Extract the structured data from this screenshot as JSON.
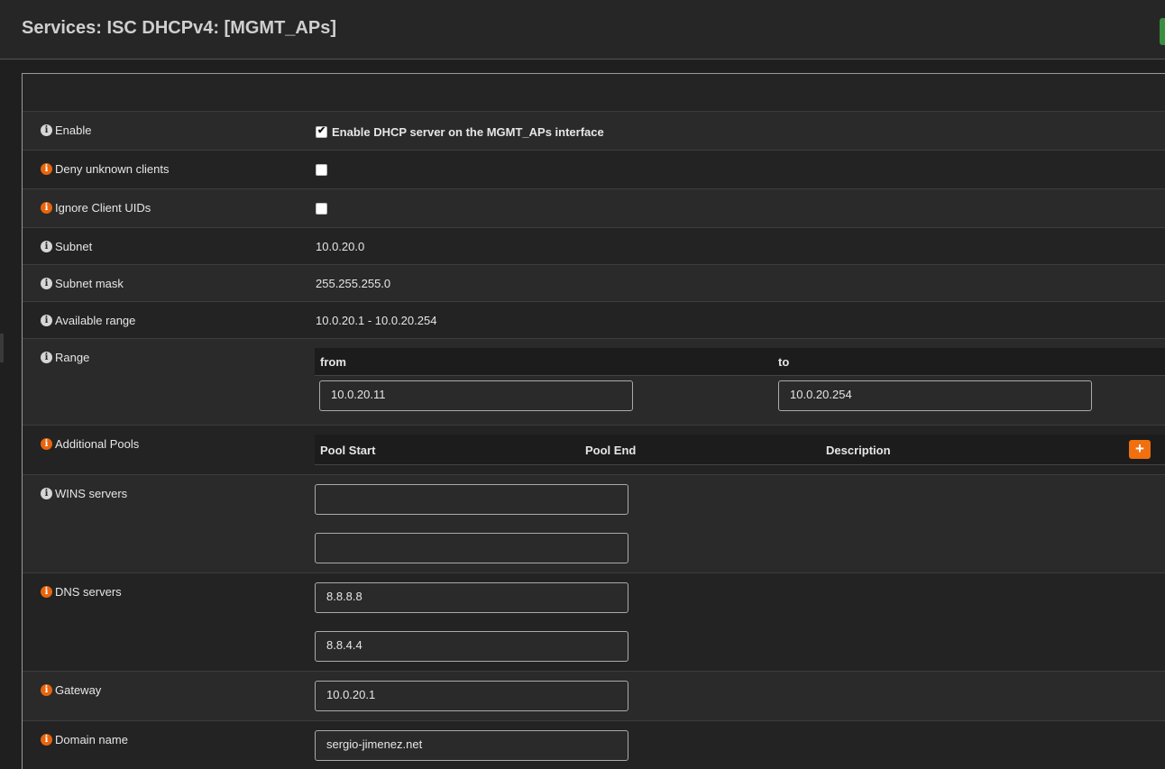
{
  "page": {
    "title": "Services: ISC DHCPv4: [MGMT_APs]"
  },
  "form": {
    "enable": {
      "label": "Enable",
      "checkbox_label": "Enable DHCP server on the MGMT_APs interface",
      "checked": true
    },
    "deny_unknown": {
      "label": "Deny unknown clients",
      "checked": false
    },
    "ignore_uids": {
      "label": "Ignore Client UIDs",
      "checked": false
    },
    "subnet": {
      "label": "Subnet",
      "value": "10.0.20.0"
    },
    "subnet_mask": {
      "label": "Subnet mask",
      "value": "255.255.255.0"
    },
    "available_range": {
      "label": "Available range",
      "value": "10.0.20.1 - 10.0.20.254"
    },
    "range": {
      "label": "Range",
      "from_label": "from",
      "to_label": "to",
      "from_value": "10.0.20.11",
      "to_value": "10.0.20.254"
    },
    "additional_pools": {
      "label": "Additional Pools",
      "col_start": "Pool Start",
      "col_end": "Pool End",
      "col_desc": "Description",
      "add_label": "+"
    },
    "wins": {
      "label": "WINS servers",
      "server1": "",
      "server2": ""
    },
    "dns": {
      "label": "DNS servers",
      "server1": "8.8.8.8",
      "server2": "8.8.4.4"
    },
    "gateway": {
      "label": "Gateway",
      "value": "10.0.20.1"
    },
    "domain": {
      "label": "Domain name",
      "value": "sergio-jimenez.net"
    }
  },
  "icons": {
    "info": "i"
  },
  "colors": {
    "accent_orange": "#f0700f",
    "status_green": "#3b8e3f"
  }
}
